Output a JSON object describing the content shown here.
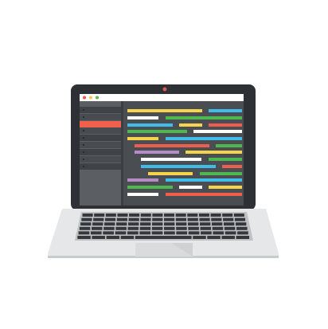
{
  "illustration": {
    "subject": "laptop-with-code-editor",
    "colors": {
      "lid": "#2d3136",
      "screen_bg": "#4a4d52",
      "sidebar": "#5b5f64",
      "sidebar_row_dark": "#3f4246",
      "sidebar_active": "#f0604d",
      "titlebar": "#ffffff",
      "body": "#e6e7e8",
      "keyboard_bg": "#bfc1c3",
      "key": "#34373b",
      "trackpad": "#cfd1d3",
      "webcam": "#e25a46"
    },
    "window_buttons": [
      "#ef5b4a",
      "#f6c843",
      "#5bb553"
    ],
    "code_colors": {
      "yellow": "#f5d44b",
      "blue": "#3fbde8",
      "white": "#ffffff",
      "green": "#4cb84f",
      "red": "#ef5e4d",
      "purple": "#b48bc4"
    },
    "code_rows": [
      [
        "yellow",
        "blue"
      ],
      [
        "white",
        "green"
      ],
      [
        "blue",
        "yellow",
        "red"
      ],
      [
        "green",
        "white"
      ],
      [
        "yellow",
        "blue"
      ],
      [
        "red",
        "green"
      ],
      [
        "purple",
        "yellow"
      ],
      [
        "white",
        "green"
      ],
      [
        "blue",
        "red"
      ],
      [
        "yellow",
        "green"
      ],
      [
        "purple",
        "blue"
      ],
      [
        "green",
        "white",
        "yellow"
      ],
      [
        "white",
        "red"
      ]
    ],
    "sidebar_active_index": 2
  }
}
